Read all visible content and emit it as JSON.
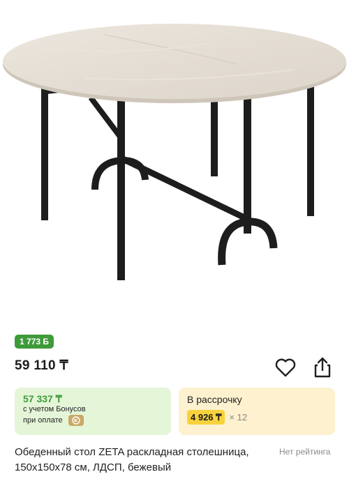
{
  "product": {
    "image_alt": "Обеденный стол ZETA",
    "bonus_badge": "1 773 Б",
    "price": "59 110 ₸",
    "title": "Обеденный стол ZETA раскладная столешница, 150x150x78 см, ЛДСП, бежевый",
    "rating": "Нет рейтинга"
  },
  "bonus_offer": {
    "price": "57 337 ₸",
    "line1": "с учетом Бонусов",
    "line2": "при оплате"
  },
  "installment": {
    "label": "В рассрочку",
    "monthly": "4 926 ₸",
    "months": "× 12"
  },
  "colors": {
    "bonus_green": "#3f9a3a",
    "bonus_card_bg": "#e4f5d8",
    "installment_bg": "#fdf1cf",
    "installment_pill": "#f8d23c"
  },
  "icons": [
    "table-image",
    "heart-icon",
    "share-icon",
    "coin-icon"
  ]
}
